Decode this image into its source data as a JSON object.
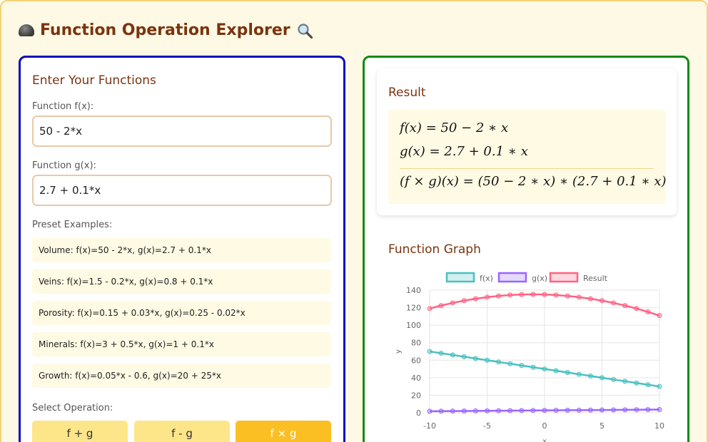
{
  "header": {
    "title": "Function Operation Explorer"
  },
  "input_panel": {
    "heading": "Enter Your Functions",
    "f_label": "Function f(x):",
    "f_value": "50 - 2*x",
    "g_label": "Function g(x):",
    "g_value": "2.7 + 0.1*x",
    "presets_label": "Preset Examples:",
    "presets": [
      "Volume: f(x)=50 - 2*x, g(x)=2.7 + 0.1*x",
      "Veins: f(x)=1.5 - 0.2*x, g(x)=0.8 + 0.1*x",
      "Porosity: f(x)=0.15 + 0.03*x, g(x)=0.25 - 0.02*x",
      "Minerals: f(x)=3 + 0.5*x, g(x)=1 + 0.1*x",
      "Growth: f(x)=0.05*x - 0.6, g(x)=20 + 25*x"
    ],
    "operation_label": "Select Operation:",
    "operations": [
      "f + g",
      "f - g",
      "f × g"
    ],
    "active_operation": 2
  },
  "result_panel": {
    "heading": "Result",
    "f_expr": "f(x) = 50 − 2 ∗ x",
    "g_expr": "g(x) = 2.7 + 0.1 ∗ x",
    "result_expr": "(f × g)(x) = (50 − 2 ∗ x) ∗ (2.7 + 0.1 ∗ x)"
  },
  "graph_panel": {
    "heading": "Function Graph"
  },
  "chart_data": {
    "type": "line",
    "title": "",
    "xlabel": "x",
    "ylabel": "y",
    "x": [
      -10,
      -9,
      -8,
      -7,
      -6,
      -5,
      -4,
      -3,
      -2,
      -1,
      0,
      1,
      2,
      3,
      4,
      5,
      6,
      7,
      8,
      9,
      10
    ],
    "xlim": [
      -10,
      10
    ],
    "ylim": [
      0,
      140
    ],
    "xticks": [
      -10,
      -5,
      0,
      5,
      10
    ],
    "yticks": [
      0,
      20,
      40,
      60,
      80,
      100,
      120,
      140
    ],
    "grid": true,
    "legend": "top-center",
    "series": [
      {
        "name": "f(x)",
        "color": "#4bc0c0",
        "values": [
          70,
          68,
          66,
          64,
          62,
          60,
          58,
          56,
          54,
          52,
          50,
          48,
          46,
          44,
          42,
          40,
          38,
          36,
          34,
          32,
          30
        ]
      },
      {
        "name": "g(x)",
        "color": "#9966ff",
        "values": [
          1.7,
          1.8,
          1.9,
          2.0,
          2.1,
          2.2,
          2.3,
          2.4,
          2.5,
          2.6,
          2.7,
          2.8,
          2.9,
          3.0,
          3.1,
          3.2,
          3.3,
          3.4,
          3.5,
          3.6,
          3.7
        ]
      },
      {
        "name": "Result",
        "color": "#ff6384",
        "values": [
          119,
          122.4,
          125.4,
          128,
          130.2,
          132,
          133.4,
          134.4,
          135,
          135.2,
          135,
          134.4,
          133.4,
          132,
          130.2,
          128,
          125.4,
          122.4,
          119,
          115.2,
          111
        ]
      }
    ]
  }
}
